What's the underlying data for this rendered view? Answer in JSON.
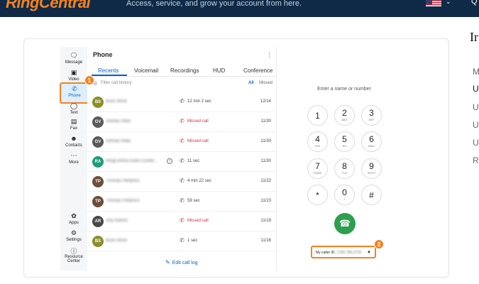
{
  "header": {
    "logo": "RingCentral",
    "tagline": "Access, service, and grow your account from here.",
    "flag_icon": "us-flag-icon",
    "chevron_icon": "chevron-down-icon",
    "search_glyph": "Q"
  },
  "article": {
    "title_fragment": "Ir",
    "side_letters": [
      "M",
      "U",
      "U",
      "U",
      "U",
      "R"
    ]
  },
  "app": {
    "nav": [
      {
        "label": "Message",
        "icon": "message-icon"
      },
      {
        "label": "Video",
        "icon": "video-icon"
      },
      {
        "label": "Phone",
        "icon": "phone-icon",
        "active": true
      },
      {
        "label": "Text",
        "icon": "text-bubble-icon"
      },
      {
        "label": "Fax",
        "icon": "fax-icon"
      },
      {
        "label": "Contacts",
        "icon": "contacts-icon"
      },
      {
        "label": "More",
        "icon": "more-icon"
      },
      {
        "label": "Apps",
        "icon": "apps-icon"
      },
      {
        "label": "Settings",
        "icon": "settings-icon"
      },
      {
        "label": "Resource Center",
        "icon": "help-icon"
      }
    ],
    "panel_title": "Phone",
    "tabs": [
      "Recents",
      "Voicemail",
      "Recordings",
      "HUD",
      "Conference"
    ],
    "active_tab": "Recents",
    "filter_placeholder": "Filter call history",
    "filter_all": "All",
    "filter_missed": "Missed",
    "calls": [
      {
        "name": "Buck Strick",
        "avatar": "BS",
        "avatar_color": "#8a8f2a",
        "status": "12 min 2 sec",
        "missed": false,
        "date": "12/14",
        "info": false
      },
      {
        "name": "Glenda Villas",
        "avatar": "GV",
        "avatar_color": "#5a5a5a",
        "status": "Missed call",
        "missed": true,
        "date": "11/30",
        "info": false
      },
      {
        "name": "Glenda Villas",
        "avatar": "GV",
        "avatar_color": "#5a5a5a",
        "status": "Missed call",
        "missed": true,
        "date": "11/30",
        "info": false
      },
      {
        "name": "RingCentral Audio Confer...",
        "avatar": "RA",
        "avatar_color": "#1f9c7a",
        "status": "11 sec",
        "missed": false,
        "date": "11/30",
        "info": true
      },
      {
        "name": "Thomas Pellanico",
        "avatar": "TP",
        "avatar_color": "#6b4f3a",
        "status": "4 min 22 sec",
        "missed": false,
        "date": "11/23",
        "info": false
      },
      {
        "name": "Thomas Pellanico",
        "avatar": "TP",
        "avatar_color": "#6b4f3a",
        "status": "59 sec",
        "missed": false,
        "date": "11/23",
        "info": false
      },
      {
        "name": "Arly Ramos",
        "avatar": "AR",
        "avatar_color": "#4a4a4a",
        "status": "Missed call",
        "missed": true,
        "date": "11/19",
        "info": false
      },
      {
        "name": "Buck Strick",
        "avatar": "BS",
        "avatar_color": "#8a8f2a",
        "status": "1 sec",
        "missed": false,
        "date": "11/16",
        "info": false
      }
    ],
    "edit_call_log": "Edit call log",
    "dialer": {
      "placeholder": "Enter a name or number",
      "keys": [
        {
          "d": "1",
          "s": ""
        },
        {
          "d": "2",
          "s": "ABC"
        },
        {
          "d": "3",
          "s": "DEF"
        },
        {
          "d": "4",
          "s": "GHI"
        },
        {
          "d": "5",
          "s": "JKL"
        },
        {
          "d": "6",
          "s": "MNO"
        },
        {
          "d": "7",
          "s": "PQRS"
        },
        {
          "d": "8",
          "s": "TUV"
        },
        {
          "d": "9",
          "s": "WXYZ"
        },
        {
          "d": "*",
          "s": ""
        },
        {
          "d": "0",
          "s": "+"
        },
        {
          "d": "#",
          "s": ""
        }
      ],
      "caller_id_label": "My caller ID:",
      "caller_id_value": "(720) 780-2733"
    },
    "callouts": [
      "1",
      "2"
    ],
    "colors": {
      "accent": "#0a63c9",
      "callout": "#f58220",
      "call_green": "#2e9e4f",
      "missed_red": "#d0303f"
    }
  }
}
